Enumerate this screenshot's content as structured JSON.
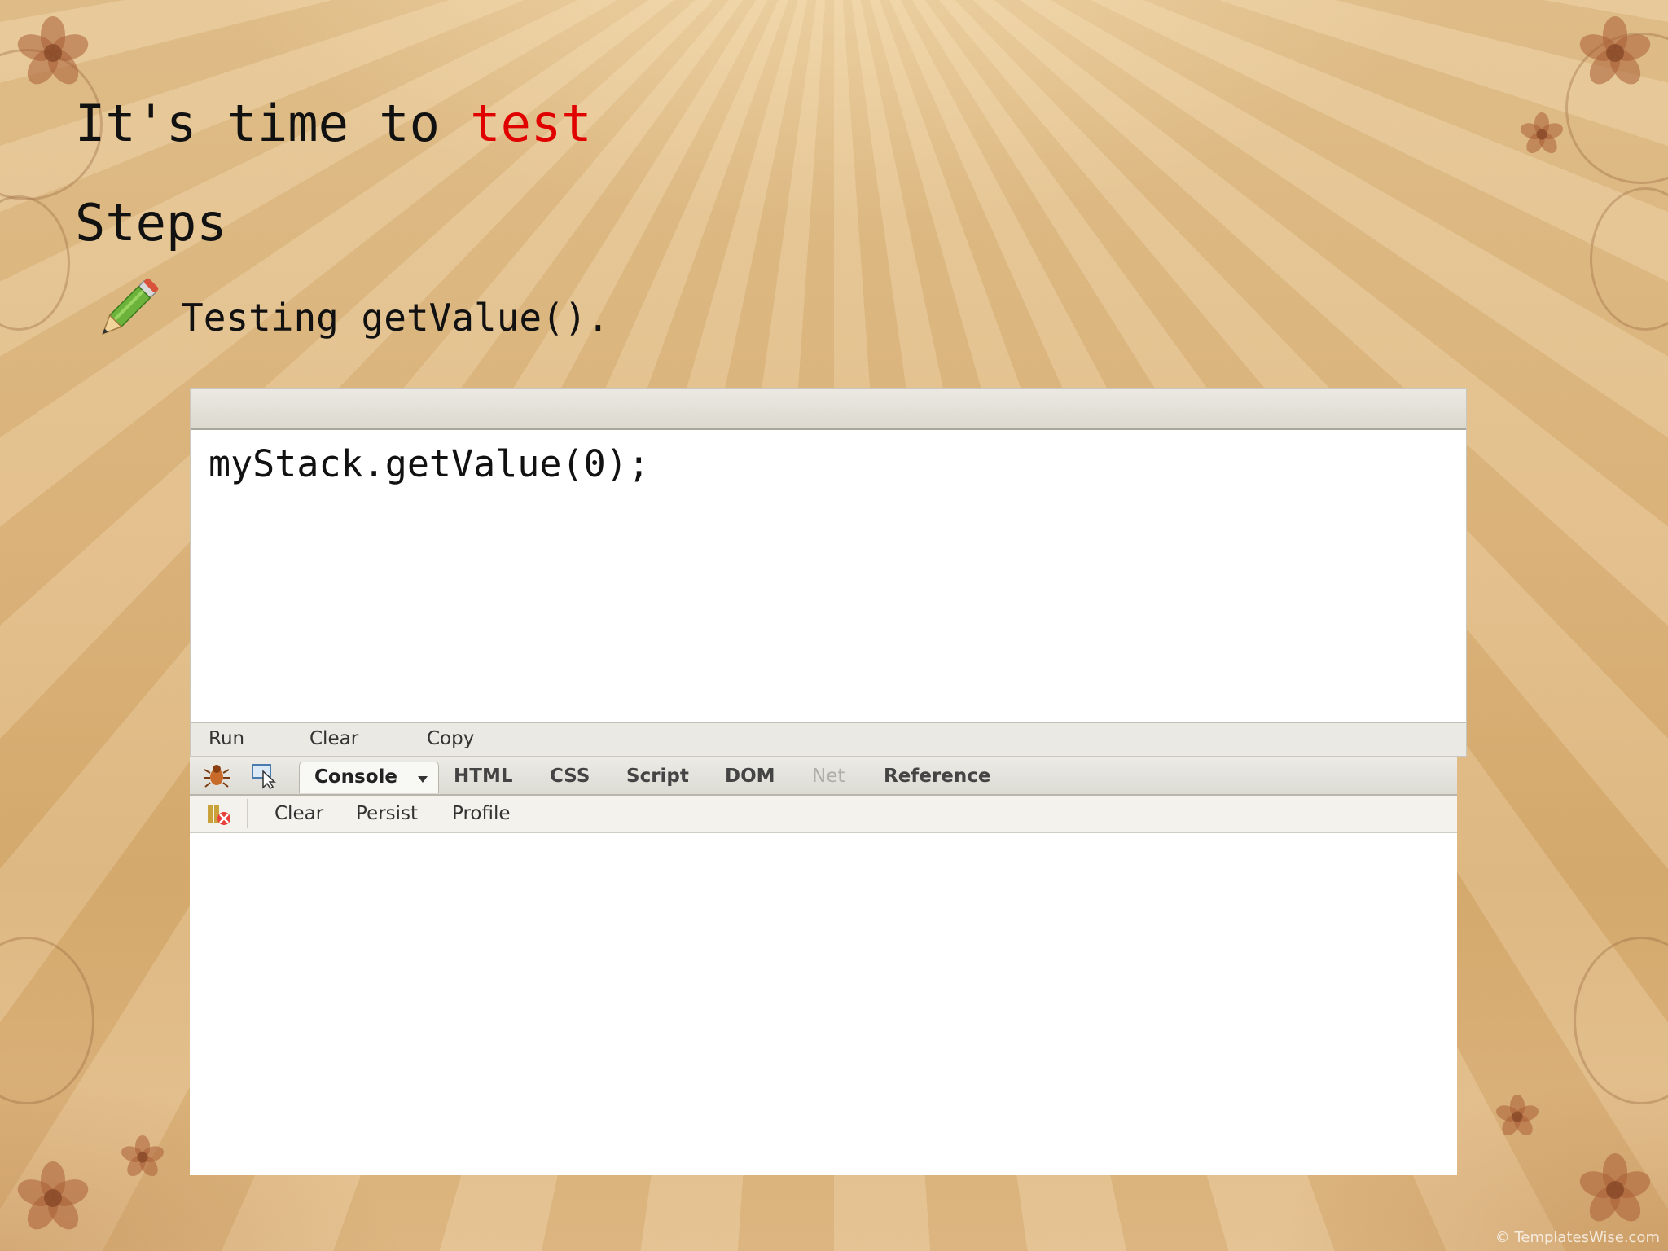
{
  "slide": {
    "title_part1": "It's time to ",
    "title_accent": "test",
    "subheading": "Steps",
    "bullet": "Testing getValue().",
    "accent_color": "#e00000",
    "watermark": "© TemplatesWise.com"
  },
  "editor": {
    "code": "myStack.getValue(0);",
    "buttons": [
      "Run",
      "Clear",
      "Copy"
    ]
  },
  "firebug": {
    "tabs": [
      "Console",
      "HTML",
      "CSS",
      "Script",
      "DOM",
      "Net",
      "Reference"
    ],
    "active_tab": "Console",
    "disabled_tab": "Net",
    "console_toolbar": [
      "Clear",
      "Persist",
      "Profile"
    ],
    "icons": [
      "firebug-bug-icon",
      "inspect-icon",
      "clear-console-icon",
      "dropdown-arrow-icon"
    ]
  }
}
